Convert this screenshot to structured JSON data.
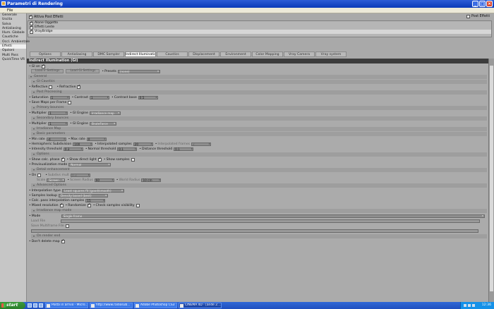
{
  "window": {
    "title": "Parametri di Rendering"
  },
  "menu": {
    "file": "File"
  },
  "sidebar": {
    "items": [
      {
        "label": "Generale"
      },
      {
        "label": "Uscita"
      },
      {
        "label": "Salva"
      },
      {
        "label": "Antialiasing"
      },
      {
        "label": "Illum. Globale"
      },
      {
        "label": "Caustiche"
      },
      {
        "label": "Occl. Ambientale"
      },
      {
        "label": "Effetti"
      },
      {
        "label": "Opzioni"
      },
      {
        "label": "Multi Pass"
      },
      {
        "label": "QuickTime VR"
      }
    ],
    "selected": "Effetti"
  },
  "top": {
    "active_post": "Attiva Post Effetti",
    "post_button": "Post Effetti"
  },
  "effects": [
    {
      "label": "Alone Oggetto"
    },
    {
      "label": "Effetti Lente"
    },
    {
      "label": "VrayBridge"
    }
  ],
  "tabs": [
    {
      "label": "Options"
    },
    {
      "label": "Antialiasing"
    },
    {
      "label": "DMC Sampler"
    },
    {
      "label": "Indirect Illumination (GI)"
    },
    {
      "label": "Caustics"
    },
    {
      "label": "Displacement"
    },
    {
      "label": "Environment"
    },
    {
      "label": "Color Mapping"
    },
    {
      "label": "Vray Camera"
    },
    {
      "label": "Vray system"
    }
  ],
  "active_tab": "Indirect Illumination (GI)",
  "panel": {
    "heading": "Indirect illumination (GI)",
    "gi_on": "GI on",
    "load_settings": "Load Ir Settings",
    "load_gi_settings": "Load Gi Settings",
    "presets_label": "Presets",
    "presets_value": "(none)",
    "sec_general": "General",
    "sec_gi_caustics": "GI Caustics",
    "reflective": "Reflective",
    "refractive": "Refractive",
    "sec_post": "Post Processing",
    "saturation": "Saturation",
    "saturation_val": "1",
    "contrast": "Contrast",
    "contrast_val": "1",
    "contrast_base": "Contrast base",
    "contrast_base_val": "0.5",
    "save_maps": "Save Maps per Frame",
    "sec_primary": "Primary bounces",
    "p_multiplier": "Multiplier",
    "p_multiplier_val": "1",
    "p_engine": "GI Engine",
    "p_engine_val": "Irradiance map",
    "sec_secondary": "Secondary bounces",
    "s_multiplier": "Multiplier",
    "s_multiplier_val": "1",
    "s_engine": "GI Engine",
    "s_engine_val": "BruteForce",
    "sec_irr_map": "Irradiance Map",
    "sec_basic": "Basic parameters",
    "min_rate": "Min rate",
    "min_rate_val": "-4",
    "max_rate": "Max rate",
    "max_rate_val": "0",
    "hemi": "Hemispheric Subdivision",
    "hemi_val": "100",
    "interp_samples": "Interpolated samples",
    "interp_samples_val": "20",
    "interp_frames": "Interpolated frames",
    "interp_frames_val": "2",
    "int_thresh": "Intensity threshold",
    "int_thresh_val": "0.3",
    "norm_thresh": "Normal threshold",
    "norm_thresh_val": "0.1",
    "dist_thresh": "Distance threshold",
    "dist_thresh_val": "0.1",
    "sec_options": "Options",
    "show_calc": "Show calc. phase",
    "show_direct": "Show direct light",
    "show_samples": "Show samples",
    "preview_mode": "Previsualization mode",
    "preview_mode_val": "Normal",
    "sec_detail": "Detail enhancement",
    "de_on": "On",
    "subdivs_mult": "Subdivs mult",
    "subdivs_mult_val": "0.3",
    "scale": "Scale",
    "scale_val": "Screen",
    "screen_radius": "Screen Radius",
    "screen_radius_val": "60",
    "world_radius": "World Radius",
    "world_radius_val": "10 cm",
    "sec_advanced": "Advanced Options",
    "interp_type": "Interpolation type",
    "interp_type_val": "Least squares fit (good/smooth)",
    "samples_lookup": "Samples lookup",
    "samples_lookup_val": "Density based (best)",
    "calc_pass": "Calc. pass interpolation samples",
    "calc_pass_val": "15",
    "mixed_res": "Mixed resolution",
    "randomize": "Randomize",
    "check_vis": "Check samples visibility",
    "sec_irr_mode": "Irradiance map mode",
    "mode": "Mode",
    "mode_val": "Single frame",
    "load_file": "Load File",
    "save_multi": "Save Multiframe File",
    "sec_onrender": "On render end",
    "dont_delete": "Don't delete map"
  },
  "taskbar": {
    "start": "start",
    "tasks": [
      {
        "label": "Posta in arrivo - Micro..."
      },
      {
        "label": "http://www.radiosub..."
      },
      {
        "label": "Adobe Photoshop CS3"
      },
      {
        "label": "CINEMA 4D - [ande 2...."
      }
    ],
    "clock": "12:36"
  }
}
